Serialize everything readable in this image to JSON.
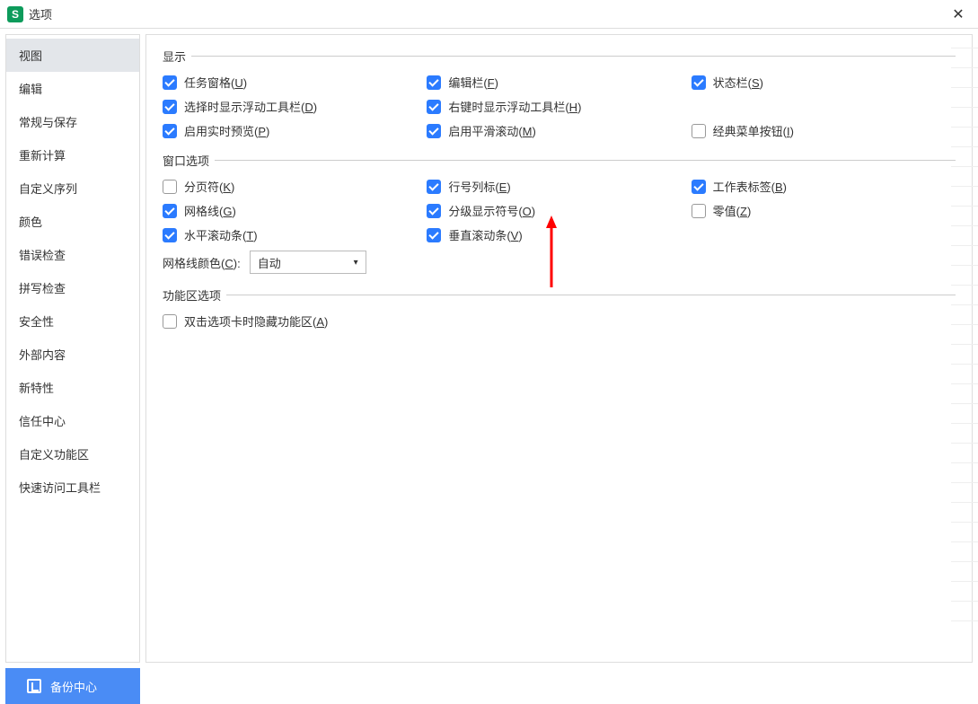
{
  "titlebar": {
    "title": "选项"
  },
  "sidebar": {
    "items": [
      "视图",
      "编辑",
      "常规与保存",
      "重新计算",
      "自定义序列",
      "颜色",
      "错误检查",
      "拼写检查",
      "安全性",
      "外部内容",
      "新特性",
      "信任中心",
      "自定义功能区",
      "快速访问工具栏"
    ],
    "activeIndex": 0
  },
  "sections": {
    "display": {
      "title": "显示",
      "rows": [
        [
          {
            "text": "任务窗格",
            "key": "U",
            "checked": true
          },
          {
            "text": "编辑栏",
            "key": "F",
            "checked": true
          },
          {
            "text": "状态栏",
            "key": "S",
            "checked": true
          }
        ],
        [
          {
            "text": "选择时显示浮动工具栏",
            "key": "D",
            "checked": true
          },
          {
            "text": "右键时显示浮动工具栏",
            "key": "H",
            "checked": true
          },
          null
        ],
        [
          {
            "text": "启用实时预览",
            "key": "P",
            "checked": true
          },
          {
            "text": "启用平滑滚动",
            "key": "M",
            "checked": true
          },
          {
            "text": "经典菜单按钮",
            "key": "I",
            "checked": false
          }
        ]
      ]
    },
    "window": {
      "title": "窗口选项",
      "rows": [
        [
          {
            "text": "分页符",
            "key": "K",
            "checked": false
          },
          {
            "text": "行号列标",
            "key": "E",
            "checked": true
          },
          {
            "text": "工作表标签",
            "key": "B",
            "checked": true
          }
        ],
        [
          {
            "text": "网格线",
            "key": "G",
            "checked": true
          },
          {
            "text": "分级显示符号",
            "key": "O",
            "checked": true
          },
          {
            "text": "零值",
            "key": "Z",
            "checked": false
          }
        ],
        [
          {
            "text": "水平滚动条",
            "key": "T",
            "checked": true
          },
          {
            "text": "垂直滚动条",
            "key": "V",
            "checked": true
          },
          null
        ]
      ],
      "gridColor": {
        "label": "网格线颜色",
        "key": "C",
        "value": "自动"
      }
    },
    "ribbon": {
      "title": "功能区选项",
      "rows": [
        [
          {
            "text": "双击选项卡时隐藏功能区",
            "key": "A",
            "checked": false
          },
          null,
          null
        ]
      ]
    }
  },
  "footer": {
    "label": "备份中心"
  }
}
